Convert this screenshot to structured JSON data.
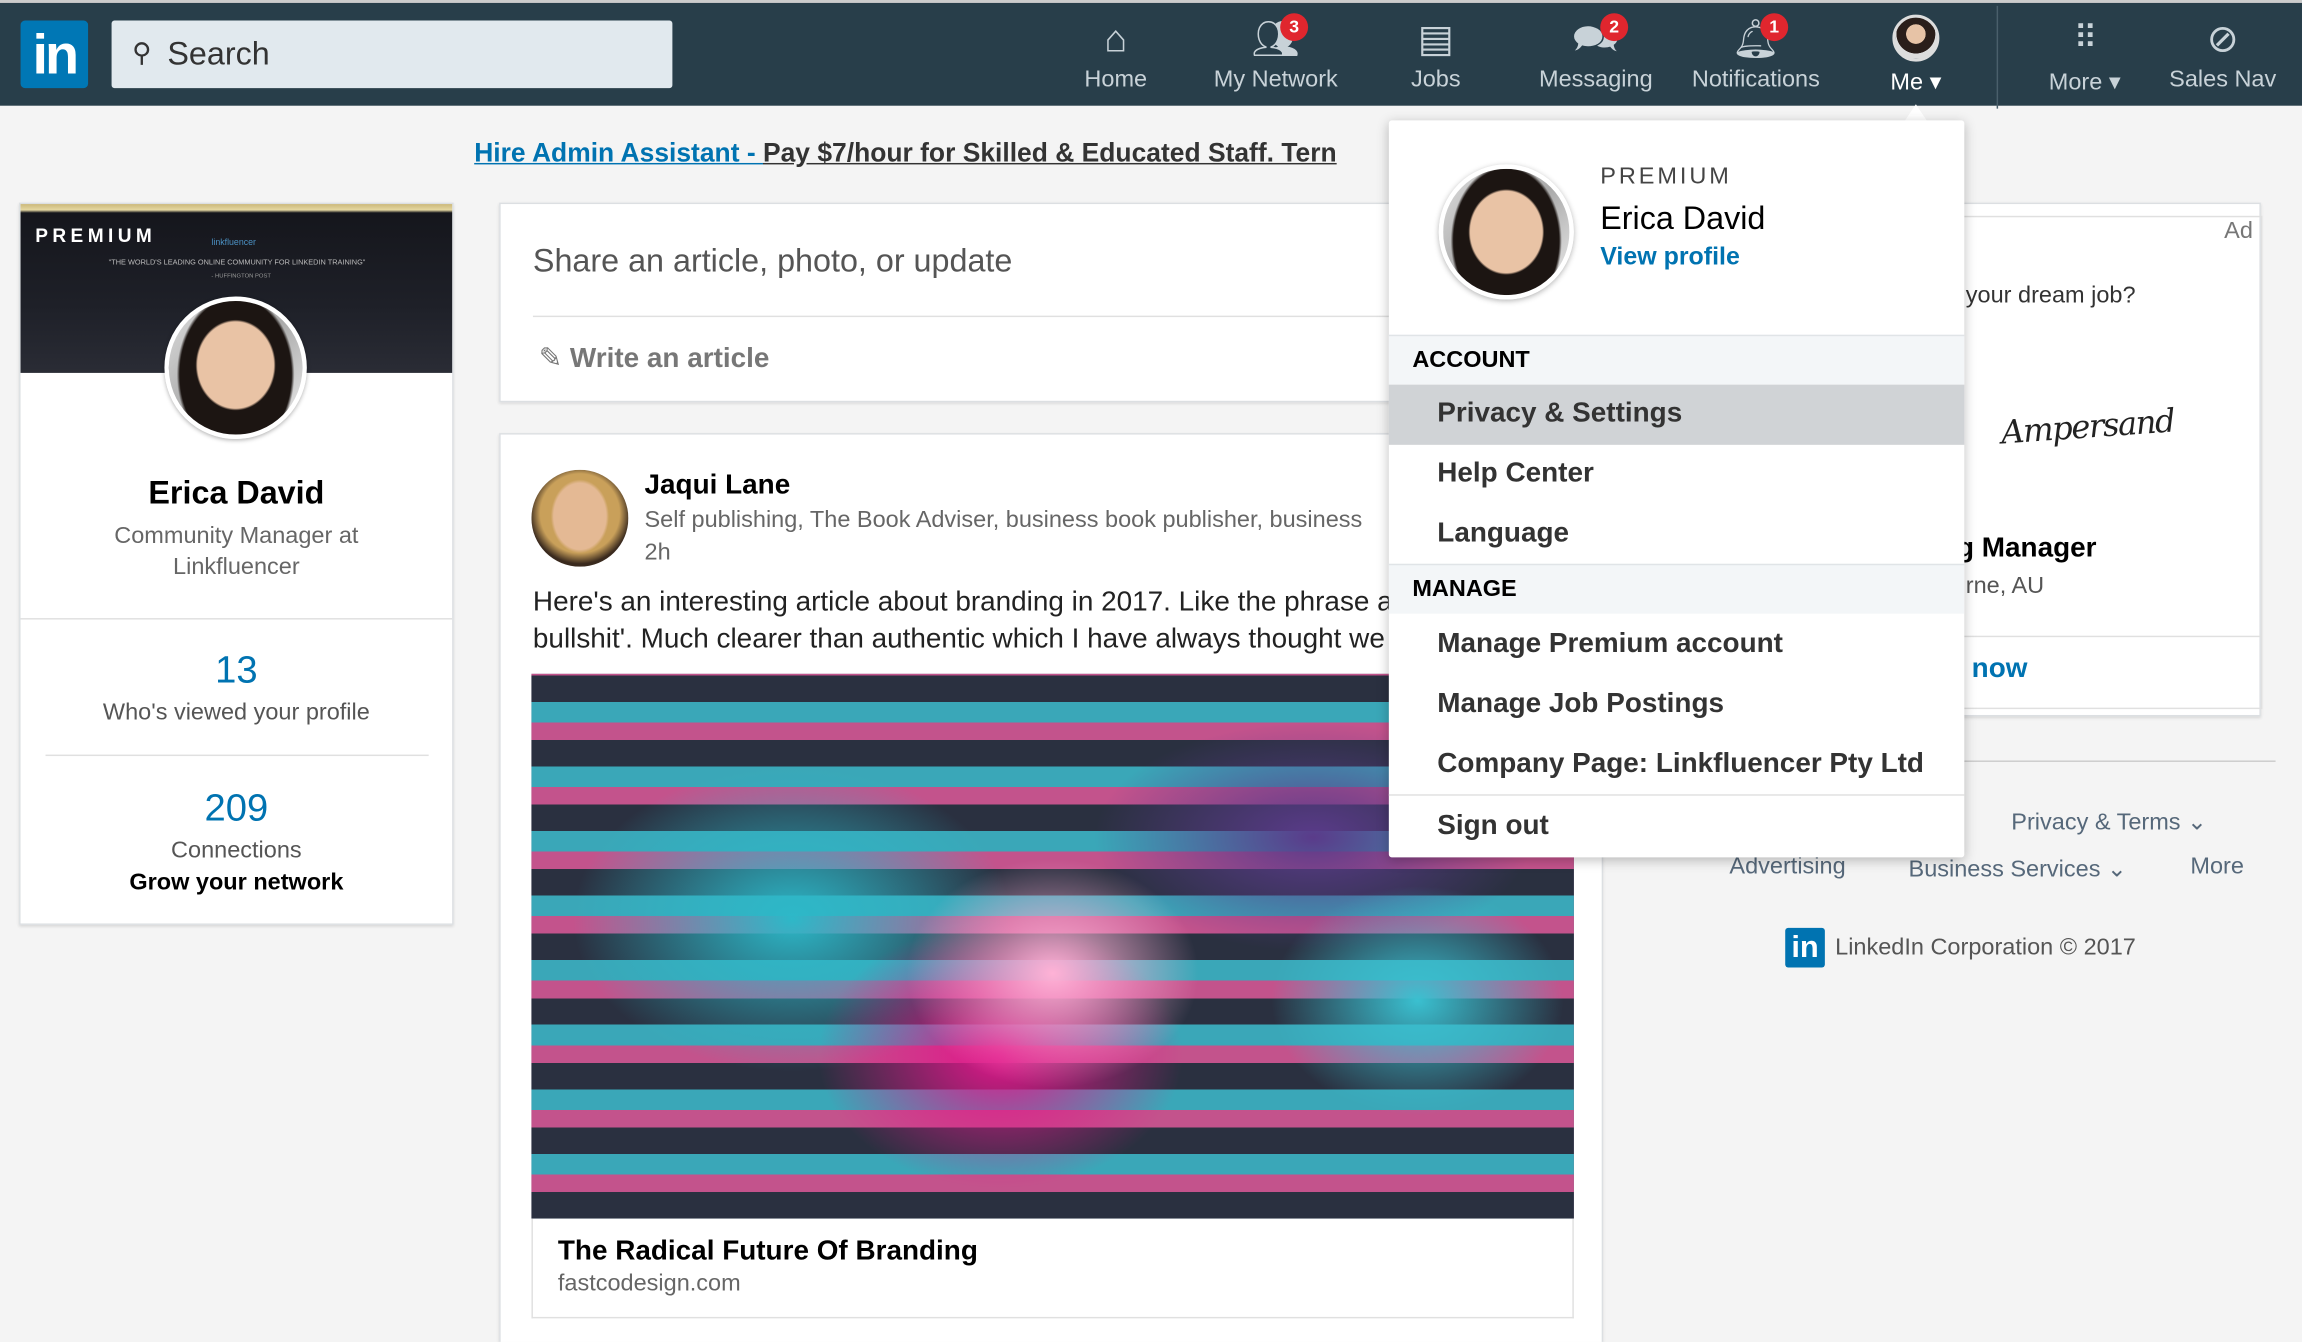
{
  "nav": {
    "logo": "in",
    "search_placeholder": "Search",
    "items": [
      {
        "label": "Home",
        "icon": "home-icon"
      },
      {
        "label": "My Network",
        "icon": "network-icon",
        "badge": "3"
      },
      {
        "label": "Jobs",
        "icon": "briefcase-icon"
      },
      {
        "label": "Messaging",
        "icon": "messaging-icon",
        "badge": "2"
      },
      {
        "label": "Notifications",
        "icon": "bell-icon",
        "badge": "1"
      },
      {
        "label": "Me",
        "icon": "avatar"
      },
      {
        "label": "More",
        "icon": "grid-icon"
      },
      {
        "label": "Sales Nav",
        "icon": "compass-icon"
      }
    ],
    "badge_color": "#e0262e"
  },
  "ad_line": {
    "link": "Hire Admin Assistant - ",
    "text": "Pay $7/hour for Skilled & Educated Staff. Tern"
  },
  "profile": {
    "banner_label": "PREMIUM",
    "banner_brand": "linkfluencer",
    "banner_quote": "\"THE WORLD'S LEADING ONLINE COMMUNITY FOR LINKEDIN TRAINING\"",
    "banner_source": "- HUFFINGTON POST",
    "name": "Erica David",
    "title": "Community Manager at Linkfluencer",
    "views_count": "13",
    "views_label": "Who's viewed your profile",
    "connections_count": "209",
    "connections_label": "Connections",
    "grow_label": "Grow your network"
  },
  "share": {
    "prompt": "Share an article, photo, or update",
    "write_article": "Write an article"
  },
  "post": {
    "author": "Jaqui Lane",
    "headline": "Self publishing, The Book Adviser, business book publisher, business",
    "time": "2h",
    "text_line1": "Here's an interesting article about branding in 2017. Like the phrase a",
    "text_line2": "bullshit'. Much clearer than authentic which I have always thought we",
    "article_title": "The Radical Future Of Branding",
    "article_domain": "fastcodesign.com"
  },
  "ad_card": {
    "ad_label": "Ad",
    "question": "your dream job?",
    "brand_signature": "Ampersand",
    "job_title": "g Manager",
    "location": "rne, AU",
    "cta": "now"
  },
  "footer": {
    "privacy_terms": "Privacy & Terms",
    "advertising": "Advertising",
    "business_services": "Business Services",
    "more": "More",
    "copyright": "LinkedIn Corporation © 2017",
    "logo": "in"
  },
  "me_menu": {
    "premium_label": "PREMIUM",
    "name": "Erica David",
    "view_profile": "View profile",
    "account_header": "ACCOUNT",
    "account_items": [
      "Privacy & Settings",
      "Help Center",
      "Language"
    ],
    "manage_header": "MANAGE",
    "manage_items": [
      "Manage Premium account",
      "Manage Job Postings",
      "Company Page: Linkfluencer Pty Ltd"
    ],
    "sign_out": "Sign out"
  },
  "colors": {
    "nav_bg": "#283e4a",
    "brand_blue": "#0073b1",
    "highlight": "#d0d3d6"
  }
}
